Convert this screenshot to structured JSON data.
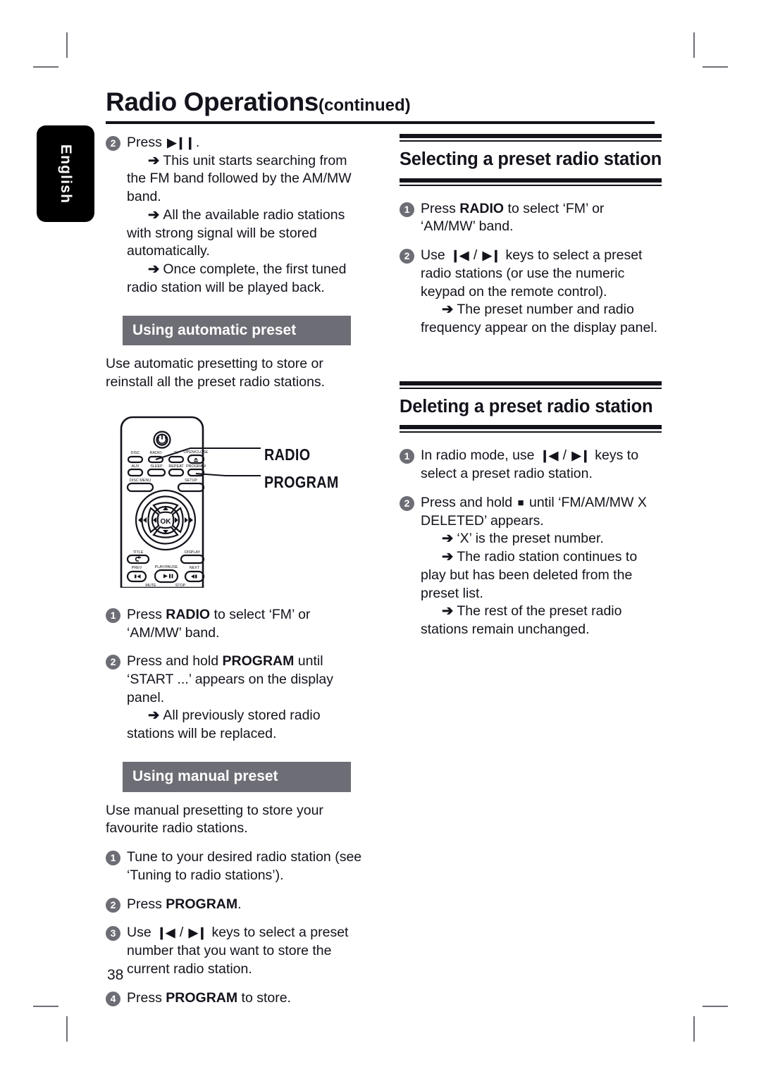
{
  "page": {
    "number": "38",
    "language_tab": "English",
    "title_main": "Radio Operations",
    "title_sub": "(continued)"
  },
  "left_column": {
    "step_play": {
      "num": "2",
      "text_prefix": "Press ",
      "key_glyph": "▶❙❙",
      "text_suffix": ".",
      "arrows": [
        "This unit starts searching from the FM band followed by the AM/MW band.",
        "All the available radio stations with strong signal will be stored automatically.",
        "Once complete, the first tuned radio station will be played back."
      ]
    },
    "auto_preset": {
      "heading": "Using automatic preset",
      "intro": "Use automatic presetting to store or reinstall all the preset radio stations.",
      "steps": [
        {
          "num": "1",
          "parts": [
            "Press ",
            "RADIO",
            " to select ‘FM’ or ‘AM/MW’ band."
          ],
          "arrows": []
        },
        {
          "num": "2",
          "parts": [
            "Press and hold ",
            "PROGRAM",
            " until ‘START ...’ appears on the display panel."
          ],
          "arrows": [
            "All previously stored radio stations will be replaced."
          ]
        }
      ]
    },
    "manual_preset": {
      "heading": "Using manual preset",
      "intro": "Use manual presetting to store your favourite radio stations.",
      "steps": [
        {
          "num": "1",
          "text": "Tune to your desired radio station (see ‘Tuning to radio stations’)."
        },
        {
          "num": "2",
          "prefix": "Press ",
          "bold": "PROGRAM",
          "suffix": "."
        },
        {
          "num": "3",
          "prefix": "Use ",
          "glyph_prev": "❙◀",
          "sep": " / ",
          "glyph_next": "▶❙",
          "suffix": " keys to select a preset number that you want to store the current radio station."
        },
        {
          "num": "4",
          "prefix": "Press ",
          "bold": "PROGRAM",
          "suffix": " to store."
        }
      ]
    },
    "remote": {
      "callout_radio": "RADIO",
      "callout_program": "PROGRAM",
      "buttons": {
        "row1": [
          "DISC",
          "RADIO",
          "TV",
          "OPEN/CLOSE"
        ],
        "row2": [
          "AUX",
          "SLEEP",
          "REPEAT",
          "PROGRAM"
        ],
        "row3": [
          "DISC MENU",
          "SETUP"
        ],
        "center": "OK",
        "row4": [
          "TITLE",
          "DISPLAY"
        ],
        "row5": [
          "PREV",
          "PLAY/PAUSE",
          "NEXT"
        ],
        "row6": [
          "MUTE",
          "STOP"
        ]
      }
    }
  },
  "right_column": {
    "selecting": {
      "title": "Selecting a preset radio station",
      "steps": [
        {
          "num": "1",
          "prefix": "Press ",
          "bold": "RADIO",
          "suffix": " to select ‘FM’ or ‘AM/MW’ band.",
          "arrows": []
        },
        {
          "num": "2",
          "prefix": "Use ",
          "glyph_prev": "❙◀",
          "sep": " / ",
          "glyph_next": "▶❙",
          "suffix": " keys to select a preset radio stations (or use the numeric keypad on the remote control).",
          "arrows": [
            "The preset number and radio frequency appear on the display panel."
          ]
        }
      ]
    },
    "deleting": {
      "title": "Deleting a preset radio station",
      "steps": [
        {
          "num": "1",
          "prefix": "In radio mode, use ",
          "glyph_prev": "❙◀",
          "sep": " / ",
          "glyph_next": "▶❙",
          "suffix": " keys to select a preset radio station.",
          "arrows": []
        },
        {
          "num": "2",
          "prefix": "Press and hold ",
          "glyph_stop": "■",
          "suffix": " until ‘FM/AM/MW X DELETED’ appears.",
          "arrows": [
            "‘X’ is the preset number.",
            "The radio station continues to play but has been deleted from the preset list.",
            "The rest of the preset radio stations remain unchanged."
          ]
        }
      ]
    }
  },
  "colors": {
    "ink": "#13131c",
    "gray_bar": "#6d6d75",
    "crop_mark": "#6e6e76"
  },
  "symbols": {
    "arrow": "➔"
  }
}
